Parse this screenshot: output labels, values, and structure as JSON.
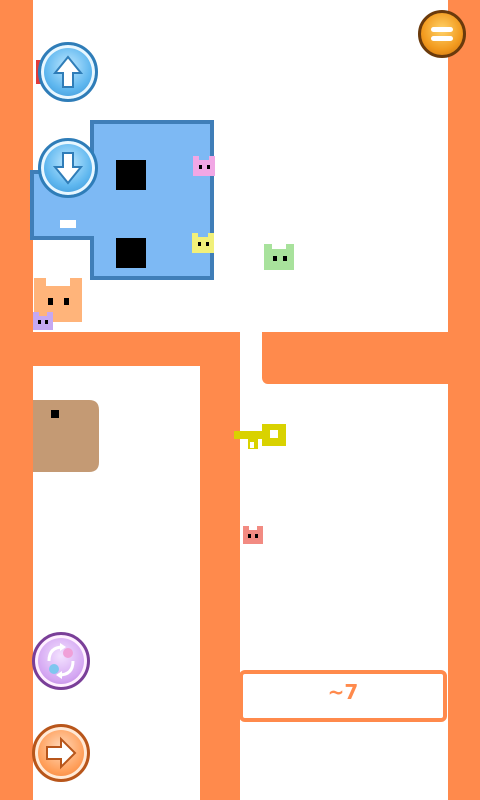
{
  "game": {
    "hint_text": "~7"
  },
  "colors": {
    "wall": "#ff8a4c",
    "big_cat": "#7db9f4",
    "big_cat_outline": "#3f7eb8",
    "box": "#c49a74",
    "key": "#d9d200",
    "hud_blue": "#5fb7ef",
    "hud_purple": "#d4a6f2",
    "hud_orange": "#ff9d57",
    "hud_menu": "#f29a1e"
  },
  "controls": [
    {
      "name": "menu-button",
      "icon": "menu-icon"
    },
    {
      "name": "up-button",
      "icon": "arrow-up-icon"
    },
    {
      "name": "down-button",
      "icon": "arrow-down-icon"
    },
    {
      "name": "swap-character-button",
      "icon": "swap-icon"
    },
    {
      "name": "move-right-button",
      "icon": "arrow-right-icon"
    }
  ],
  "characters": [
    {
      "name": "big-blue-cat",
      "color": "#7db9f4"
    },
    {
      "name": "pink-cat",
      "color": "#f1a7e5"
    },
    {
      "name": "yellow-cat",
      "color": "#f1f07a"
    },
    {
      "name": "green-cat",
      "color": "#a8e29c"
    },
    {
      "name": "orange-cat",
      "color": "#ffb47a"
    },
    {
      "name": "lilac-cat",
      "color": "#c5a8f2"
    },
    {
      "name": "red-cat",
      "color": "#f28b82"
    }
  ]
}
